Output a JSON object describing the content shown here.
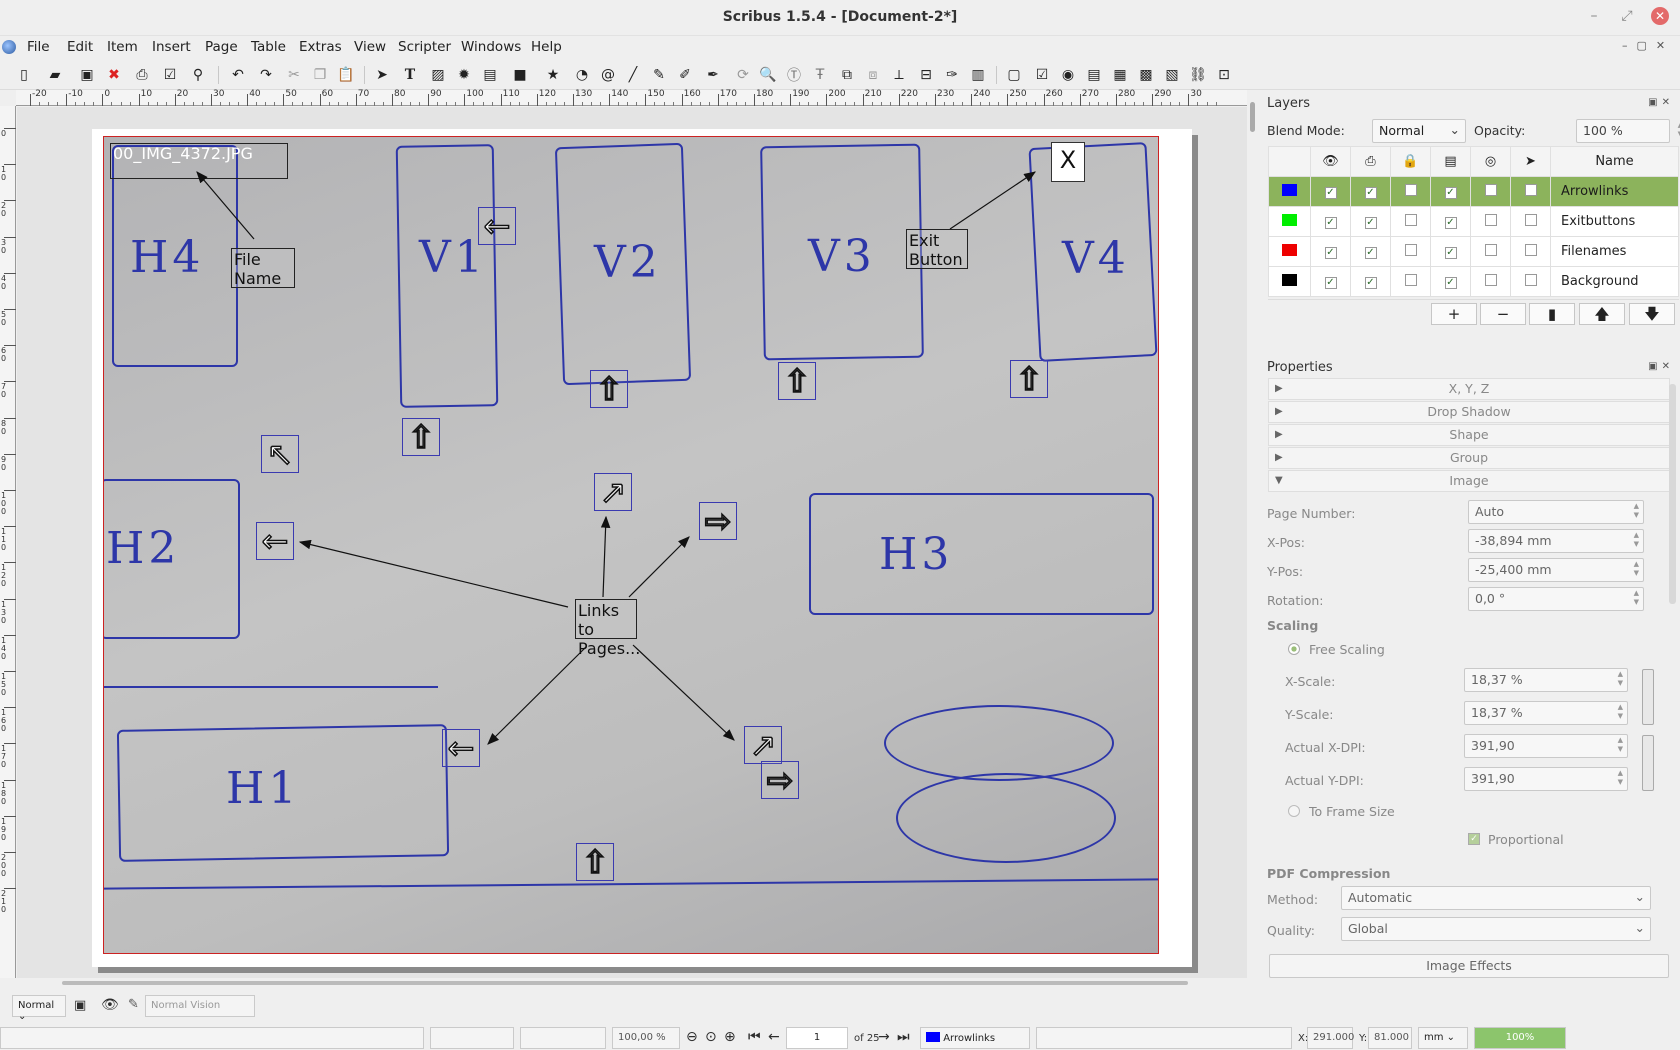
{
  "window": {
    "title": "Scribus 1.5.4 - [Document-2*]"
  },
  "menu": [
    "File",
    "Edit",
    "Item",
    "Insert",
    "Page",
    "Table",
    "Extras",
    "View",
    "Scripter",
    "Windows",
    "Help"
  ],
  "rulers": {
    "h": [
      "-20",
      "-10",
      "0",
      "10",
      "20",
      "30",
      "40",
      "50",
      "60",
      "70",
      "80",
      "90",
      "100",
      "110",
      "120",
      "130",
      "140",
      "150",
      "160",
      "170",
      "180",
      "190",
      "200",
      "210",
      "220",
      "230",
      "240",
      "250",
      "260",
      "270",
      "280",
      "290",
      "30"
    ],
    "v": [
      "0",
      "10",
      "20",
      "30",
      "40",
      "50",
      "60",
      "70",
      "80",
      "90",
      "100",
      "110",
      "120",
      "130",
      "140",
      "150",
      "160",
      "170",
      "180",
      "190",
      "200",
      "210"
    ]
  },
  "canvas": {
    "sketch_labels": [
      "H4",
      "V1",
      "V2",
      "V3",
      "V4",
      "H2",
      "H3",
      "H1"
    ],
    "filename_frame": "00_IMG_4372.JPG",
    "filename_callout": "File Name",
    "exit_callout": "Exit Button",
    "exit_button": "X",
    "links_callout": "Links to Pages...",
    "arrows": [
      "←",
      "⇧",
      "⇧",
      "⇧",
      "⇧",
      "↖",
      "↗",
      "⇨",
      "←",
      "←",
      "↗",
      "⇨",
      "⇧"
    ]
  },
  "layers_panel": {
    "title": "Layers",
    "blend_label": "Blend Mode:",
    "blend_value": "Normal",
    "opacity_label": "Opacity:",
    "opacity_value": "100 %",
    "name_header": "Name",
    "rows": [
      {
        "name": "Arrowlinks",
        "color": "#0000ff",
        "selected": true
      },
      {
        "name": "Exitbuttons",
        "color": "#00ee00",
        "selected": false
      },
      {
        "name": "Filenames",
        "color": "#ee0000",
        "selected": false
      },
      {
        "name": "Background",
        "color": "#000000",
        "selected": false
      }
    ],
    "buttons": [
      "+",
      "−",
      "▮",
      "🡅",
      "🡇"
    ]
  },
  "properties": {
    "title": "Properties",
    "sections": [
      "X, Y, Z",
      "Drop Shadow",
      "Shape",
      "Group",
      "Image"
    ],
    "page_number_label": "Page Number:",
    "page_number": "Auto",
    "xpos_label": "X-Pos:",
    "xpos": "-38,894 mm",
    "ypos_label": "Y-Pos:",
    "ypos": "-25,400 mm",
    "rotation_label": "Rotation:",
    "rotation": "0,0 °",
    "scaling_label": "Scaling",
    "free_scaling": "Free Scaling",
    "xscale_label": "X-Scale:",
    "xscale": "18,37 %",
    "yscale_label": "Y-Scale:",
    "yscale": "18,37 %",
    "xdpi_label": "Actual X-DPI:",
    "xdpi": "391,90",
    "ydpi_label": "Actual Y-DPI:",
    "ydpi": "391,90",
    "to_frame": "To Frame Size",
    "proportional": "Proportional",
    "pdf_label": "PDF Compression",
    "method_label": "Method:",
    "method": "Automatic",
    "quality_label": "Quality:",
    "quality": "Global",
    "effects_button": "Image Effects"
  },
  "status": {
    "mode": "Normal",
    "vision": "Normal Vision",
    "zoom": "100,00 %",
    "page": "1",
    "of_pages": "of 25",
    "layer": "Arrowlinks",
    "x_label": "X:",
    "x": "291.000",
    "y_label": "Y:",
    "y": "81.000",
    "unit": "mm",
    "progress": "100%"
  }
}
